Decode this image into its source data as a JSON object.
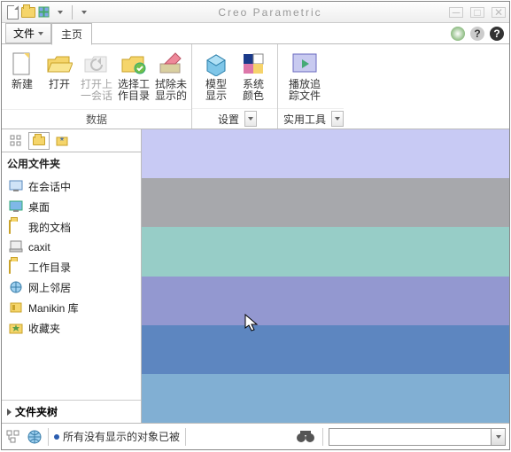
{
  "title": "Creo Parametric",
  "tabs": {
    "file": "文件",
    "home": "主页"
  },
  "ribbon": {
    "group_data": "数据",
    "group_settings": "设置",
    "group_utils": "实用工具",
    "new": "新建",
    "open": "打开",
    "open_last": "打开上\n一会话",
    "select_wd": "选择工\n作目录",
    "erase": "拭除未\n显示的",
    "model_disp": "模型\n显示",
    "sys_color": "系统\n颜色",
    "play_trace": "播放追\n踪文件"
  },
  "sidebar": {
    "header": "公用文件夹",
    "items": [
      "在会话中",
      "桌面",
      "我的文档",
      "caxit",
      "工作目录",
      "网上邻居",
      "Manikin 库",
      "收藏夹"
    ],
    "tree": "文件夹树"
  },
  "status": {
    "msg": "所有没有显示的对象已被"
  },
  "bands": [
    "#c8caf4",
    "#a7a8ac",
    "#97cdc7",
    "#9398d0",
    "#5d86c0",
    "#81afd3"
  ]
}
